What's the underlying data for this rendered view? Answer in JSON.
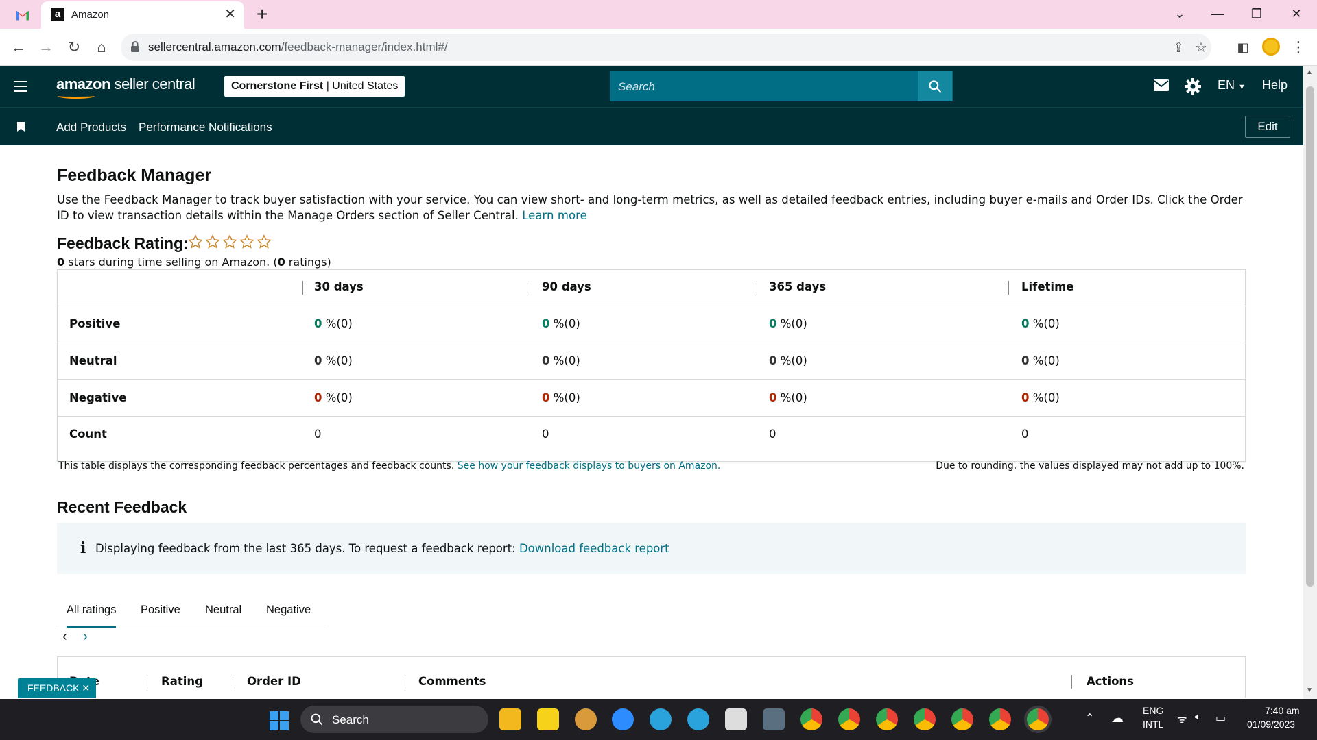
{
  "browser": {
    "tab_title": "Amazon",
    "url_host": "sellercentral.amazon.com",
    "url_path": "/feedback-manager/index.html#/"
  },
  "header": {
    "logo_bold": "amazon",
    "logo_rest": " seller central",
    "store_name": "Cornerstone First",
    "store_sep": " | ",
    "store_region": "United States",
    "search_placeholder": "Search",
    "language": "EN",
    "help": "Help"
  },
  "subnav": {
    "add_products": "Add Products",
    "performance_notifications": "Performance Notifications",
    "edit": "Edit"
  },
  "page": {
    "title": "Feedback Manager",
    "description": "Use the Feedback Manager to track buyer satisfaction with your service. You can view short- and long-term metrics, as well as detailed feedback entries, including buyer e-mails and Order IDs. Click the Order ID to view transaction details within the Manage Orders section of Seller Central.",
    "learn_more": "Learn more",
    "rating_title": "Feedback Rating:",
    "stars_count": "0",
    "stars_text_a": " stars during time selling on Amazon. (",
    "ratings_count": "0",
    "stars_text_b": " ratings)",
    "star_rating_value": 0
  },
  "table": {
    "columns": [
      "30 days",
      "90 days",
      "365 days",
      "Lifetime"
    ],
    "rows": [
      {
        "label": "Positive",
        "values": [
          "0",
          "0",
          "0",
          "0"
        ],
        "suffix": " %(0)",
        "tone": "green"
      },
      {
        "label": "Neutral",
        "values": [
          "0",
          "0",
          "0",
          "0"
        ],
        "suffix": " %(0)",
        "tone": "grey"
      },
      {
        "label": "Negative",
        "values": [
          "0",
          "0",
          "0",
          "0"
        ],
        "suffix": " %(0)",
        "tone": "red"
      },
      {
        "label": "Count",
        "values": [
          "0",
          "0",
          "0",
          "0"
        ],
        "suffix": "",
        "tone": "plain"
      }
    ],
    "note_left": "This table displays the corresponding feedback percentages and feedback counts.",
    "note_link": "See how your feedback displays to buyers on Amazon.",
    "note_right": "Due to rounding, the values displayed may not add up to 100%."
  },
  "recent": {
    "title": "Recent Feedback",
    "info_text": "Displaying feedback from the last 365 days. To request a feedback report:",
    "info_link": "Download feedback report",
    "tabs": [
      "All ratings",
      "Positive",
      "Neutral",
      "Negative"
    ],
    "list_columns": [
      "Date",
      "Rating",
      "Order ID",
      "Comments",
      "Actions"
    ]
  },
  "feedback_button": "FEEDBACK",
  "taskbar": {
    "search": "Search",
    "lang_top": "ENG",
    "lang_bottom": "INTL",
    "time": "7:40 am",
    "date": "01/09/2023"
  },
  "colors": {
    "header_bg": "#002f36",
    "search_bg": "#026e86",
    "link": "#007185",
    "positive": "#067d62",
    "negative": "#b12704",
    "star": "#c7882b"
  }
}
